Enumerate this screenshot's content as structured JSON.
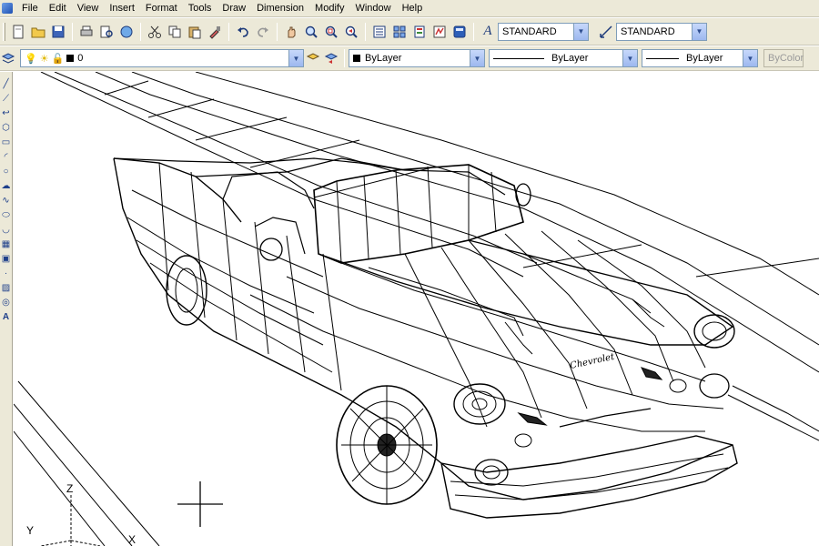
{
  "menu": {
    "items": [
      "File",
      "Edit",
      "View",
      "Insert",
      "Format",
      "Tools",
      "Draw",
      "Dimension",
      "Modify",
      "Window",
      "Help"
    ]
  },
  "styles": {
    "text_style": "STANDARD",
    "dim_style": "STANDARD"
  },
  "layers": {
    "current_layer": "0",
    "color": "ByLayer",
    "linetype": "ByLayer",
    "lineweight": "ByLayer",
    "plotstyle": "ByColor"
  },
  "ucs": {
    "x_label": "X",
    "y_label": "Y",
    "z_label": "Z"
  },
  "car_badge": "Chevrolet",
  "icons": {
    "toolbar1": [
      "new-icon",
      "open-icon",
      "save-icon",
      "plot-icon",
      "preview-icon",
      "publish-icon",
      "cut-icon",
      "copy-icon",
      "paste-icon",
      "matchprop-icon",
      "undo-icon",
      "redo-icon",
      "pan-icon",
      "zoom-realtime-icon",
      "zoom-window-icon",
      "zoom-previous-icon",
      "properties-icon",
      "designcenter-icon",
      "toolpalettes-icon",
      "markup-icon",
      "calculator-icon"
    ],
    "toolbar2": [
      "layer-manager-icon",
      "layer-state-icon"
    ],
    "left": [
      "line-icon",
      "construction-line-icon",
      "polyline-icon",
      "polygon-icon",
      "rectangle-icon",
      "arc-icon",
      "circle-icon",
      "revcloud-icon",
      "spline-icon",
      "ellipse-icon",
      "ellipse-arc-icon",
      "insert-block-icon",
      "make-block-icon",
      "point-icon",
      "hatch-icon",
      "region-icon",
      "mtext-icon"
    ]
  }
}
